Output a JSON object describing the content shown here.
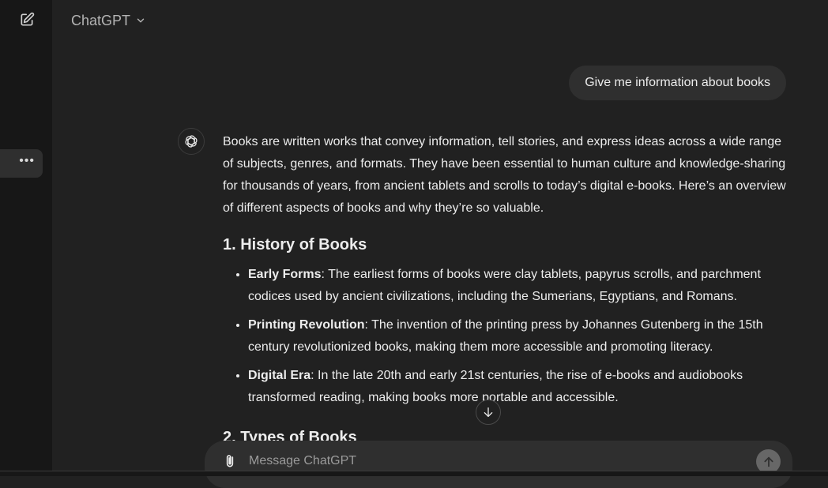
{
  "header": {
    "model_label": "ChatGPT",
    "new_chat_icon": "edit-icon",
    "chevron_icon": "chevron-down-icon"
  },
  "sidebar": {
    "more_label": "•••"
  },
  "conversation": {
    "user_message": "Give me information about books",
    "assistant": {
      "intro": "Books are written works that convey information, tell stories, and express ideas across a wide range of subjects, genres, and formats. They have been essential to human culture and knowledge-sharing for thousands of years, from ancient tablets and scrolls to today’s digital e-books. Here’s an overview of different aspects of books and why they’re so valuable.",
      "sections": [
        {
          "heading": "1. History of Books",
          "items": [
            {
              "term": "Early Forms",
              "text": ": The earliest forms of books were clay tablets, papyrus scrolls, and parchment codices used by ancient civilizations, including the Sumerians, Egyptians, and Romans."
            },
            {
              "term": "Printing Revolution",
              "text": ": The invention of the printing press by Johannes Gutenberg in the 15th century revolutionized books, making them more accessible and promoting literacy."
            },
            {
              "term": "Digital Era",
              "text": ": In the late 20th and early 21st centuries, the rise of e-books and audiobooks transformed reading, making books more portable and accessible."
            }
          ]
        },
        {
          "heading": "2. Types of Books"
        }
      ]
    }
  },
  "composer": {
    "placeholder": "Message ChatGPT"
  },
  "colors": {
    "background": "#212121",
    "sidebar": "#171717",
    "bubble": "#2f2f2f",
    "text": "#ececec",
    "muted": "#b4b4b4"
  }
}
